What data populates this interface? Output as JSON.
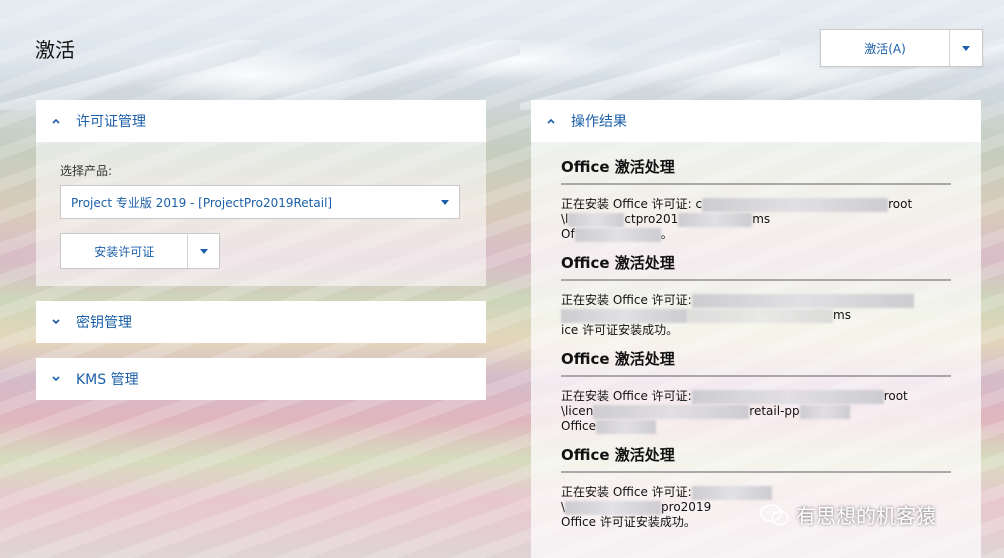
{
  "page": {
    "title": "激活"
  },
  "header": {
    "activate_label": "激活(A)"
  },
  "license_panel": {
    "title": "许可证管理",
    "select_label": "选择产品:",
    "selected_product": "Project 专业版 2019 - [ProjectPro2019Retail]",
    "install_label": "安装许可证"
  },
  "keys_panel": {
    "title": "密钥管理"
  },
  "kms_panel": {
    "title": "KMS 管理"
  },
  "results_panel": {
    "title": "操作结果",
    "groups": [
      {
        "title": "Office 激活处理",
        "line1": "正在安装 Office 许可证: c",
        "line1_tail": "root",
        "line2": "\\l",
        "line2_mid": "ctpro201",
        "line2_tail": "ms",
        "line3": "Of",
        "line3_tail": "。"
      },
      {
        "title": "Office 激活处理",
        "line1": "正在安装 Office 许可证:",
        "line1_tail": "",
        "line2": "",
        "line2_mid": "",
        "line2_tail": "ms",
        "line3": "ice 许可证安装成功。",
        "line3_tail": ""
      },
      {
        "title": "Office 激活处理",
        "line1": "正在安装 Office 许可证:",
        "line1_tail": "root",
        "line2": "\\licen",
        "line2_mid": "retail-pp",
        "line2_tail": "",
        "line3": "Office",
        "line3_tail": ""
      },
      {
        "title": "Office 激活处理",
        "line1": "正在安装 Office 许可证:",
        "line1_tail": "",
        "line2": "\\",
        "line2_mid": "pro2019",
        "line2_tail": "",
        "line3": "Office 许可证安装成功。",
        "line3_tail": ""
      }
    ]
  },
  "watermark": {
    "text": "有思想的机客猿"
  },
  "colors": {
    "accent": "#1b5fa8"
  }
}
